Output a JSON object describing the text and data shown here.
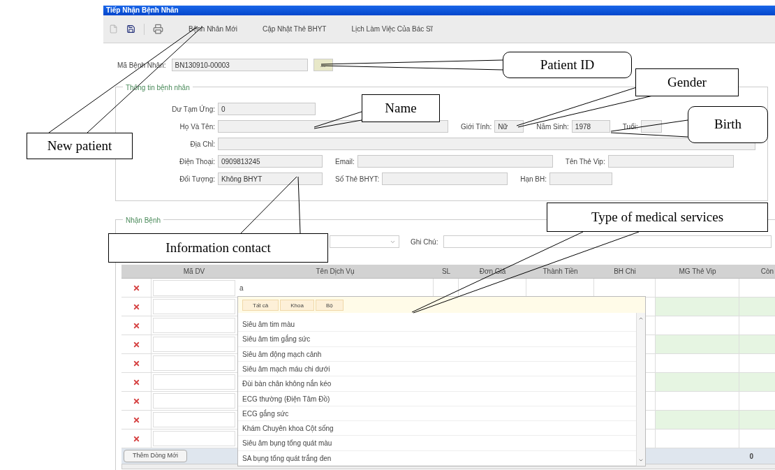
{
  "window": {
    "title": "Tiếp Nhận Bệnh Nhân"
  },
  "toolbar": {
    "menu": [
      "Bệnh Nhân Mới",
      "Cập Nhật Thẻ BHYT",
      "Lịch Làm Việc Của Bác Sĩ"
    ]
  },
  "patient_id": {
    "label": "Mã Bệnh Nhân:",
    "value": "BN130910-00003",
    "button": "..."
  },
  "patient_info": {
    "title": "Thông tin bệnh nhân",
    "rows": [
      [
        {
          "label": "Dư Tạm Ứng:",
          "value": "0"
        }
      ],
      [
        {
          "label": "Họ Và Tên:"
        },
        {
          "label": "Giới Tính:",
          "value": "Nữ"
        },
        {
          "label": "Năm Sinh:",
          "value": "1978"
        },
        {
          "label": "Tuổi:"
        }
      ],
      [
        {
          "label": "Địa Chỉ:"
        }
      ],
      [
        {
          "label": "Điện Thoại:",
          "value": "0909813245"
        },
        {
          "label": "Email:"
        },
        {
          "label": "Tên Thẻ Vip:"
        }
      ],
      [
        {
          "label": "Đối Tượng:",
          "value": "Không BHYT"
        },
        {
          "label": "Số Thẻ BHYT:"
        },
        {
          "label": "Hạn BH:"
        }
      ]
    ]
  },
  "reception": {
    "title": "Nhận Bệnh",
    "note_label": "Ghi Chú:",
    "table": {
      "columns": [
        "Mã DV",
        "Tên Dịch Vụ",
        "SL",
        "Đơn Giá",
        "Thành Tiền",
        "BH Chi",
        "MG Thẻ Vip",
        "Còn"
      ],
      "rows": [
        {
          "kind": "filled",
          "service": "a"
        },
        {
          "kind": "empty"
        },
        {
          "kind": "empty"
        },
        {
          "kind": "empty"
        },
        {
          "kind": "empty"
        },
        {
          "kind": "empty"
        },
        {
          "kind": "empty"
        },
        {
          "kind": "empty"
        },
        {
          "kind": "empty"
        }
      ]
    },
    "add_row_button": "Thêm Dòng Mới",
    "total": "0",
    "dropdown": {
      "tabs": [
        "Tất cả",
        "Khoa",
        "Bộ"
      ],
      "items": [
        "Siêu âm tim màu",
        "Siêu âm tim gắng sức",
        "Siêu âm động mạch cảnh",
        "Siêu âm mạch máu chi dưới",
        "Đùi bàn chân không nắn kéo",
        "ECG thường (Điện Tâm Đồ)",
        "ECG gắng sức",
        "Khám Chuyên khoa Cột sống",
        "Siêu âm bụng tổng quát màu",
        "SA bụng tổng quát trắng đen"
      ]
    }
  },
  "callouts": [
    {
      "text": "Patient ID",
      "kind": "rounded"
    },
    {
      "text": "Gender",
      "kind": "rect"
    },
    {
      "text": "Name",
      "kind": "rect"
    },
    {
      "text": "Birth",
      "kind": "rounded"
    },
    {
      "text": "New patient",
      "kind": "rect"
    },
    {
      "text": "Information contact",
      "kind": "rect"
    },
    {
      "text": "Type of medical services",
      "kind": "rect"
    }
  ]
}
